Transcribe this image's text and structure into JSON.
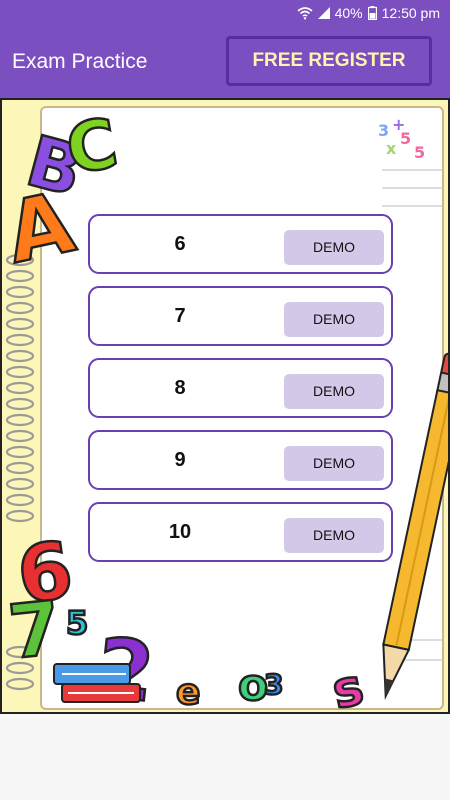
{
  "status": {
    "battery": "40%",
    "time": "12:50 pm"
  },
  "header": {
    "title": "Exam Practice",
    "register_label": "FREE REGISTER"
  },
  "grades": [
    {
      "label": "6",
      "button": "DEMO"
    },
    {
      "label": "7",
      "button": "DEMO"
    },
    {
      "label": "8",
      "button": "DEMO"
    },
    {
      "label": "9",
      "button": "DEMO"
    },
    {
      "label": "10",
      "button": "DEMO"
    }
  ],
  "decor": {
    "letters": "ABC",
    "numbers": [
      "6",
      "7",
      "5",
      "2",
      "3"
    ]
  },
  "colors": {
    "primary": "#7c4fc1",
    "button_fill": "#d4c8e8",
    "row_border": "#6a3fb0"
  }
}
